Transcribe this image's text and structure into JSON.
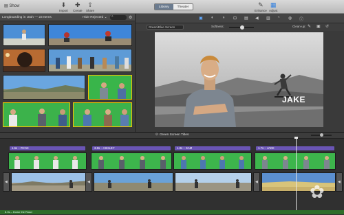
{
  "toolbar": {
    "show_label": "Show",
    "import_label": "Import",
    "create_label": "Create",
    "share_label": "Share",
    "library_label": "Library",
    "theater_label": "Theater",
    "enhance_label": "Enhance",
    "adjust_label": "Adjust"
  },
  "browser": {
    "project_label": "Longboarding in Utah — 23 Items",
    "hide_rejected_label": "Hide Rejected ⌄"
  },
  "viewer": {
    "effect_select": "Green/Blue Screen",
    "softness_label": "Softness:",
    "cleanup_label": "Clean-up:",
    "caption": "JAKE"
  },
  "timeline": {
    "title": "Green Screen Titles",
    "title_clips": [
      {
        "label": "1.6s – RYAN"
      },
      {
        "label": "3.8s – ASHLEY"
      },
      {
        "label": "1.8s – SAM"
      },
      {
        "label": "1.7s – JAKE"
      }
    ],
    "audio_label": "8.0s – Down the Road"
  },
  "colors": {
    "accent": "#5fa8ff",
    "title_purple": "#6a55b5",
    "greenscreen": "#39b54a",
    "audio_green": "#2f6e2a"
  },
  "icons": [
    "show-icon",
    "import-icon",
    "create-icon",
    "share-icon",
    "enhance-icon",
    "adjust-icon",
    "search-icon",
    "gear-icon"
  ]
}
